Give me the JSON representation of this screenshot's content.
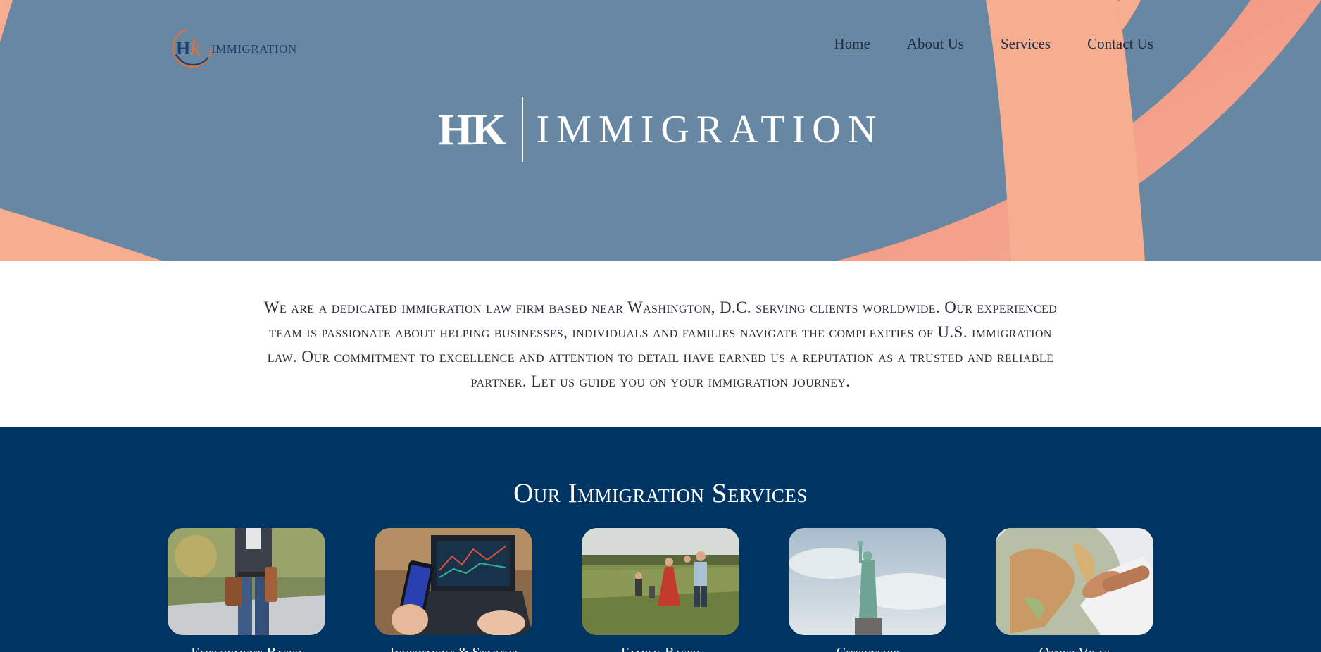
{
  "header": {
    "logo_text": "IMMIGRATION",
    "logo_mark_text": "HK"
  },
  "nav": {
    "items": [
      {
        "label": "Home",
        "active": true
      },
      {
        "label": "About Us",
        "active": false
      },
      {
        "label": "Services",
        "active": false
      },
      {
        "label": "Contact Us",
        "active": false
      }
    ]
  },
  "hero": {
    "brand_hk": "HK",
    "brand_word": "IMMIGRATION"
  },
  "intro": {
    "text": "We are a dedicated immigration law firm based near Washington, D.C. serving clients worldwide. Our experienced team is passionate about helping businesses, individuals and families navigate the complexities of U.S. immigration law. Our commitment to excellence and attention to detail have earned us a reputation as a trusted and reliable partner. Let us guide you on your immigration journey."
  },
  "services": {
    "title": "Our Immigration Services",
    "cards": [
      {
        "label": "Employment-Based",
        "image": "businessman-with-briefcase"
      },
      {
        "label": "Investment & Startup",
        "image": "phone-and-laptop-trading"
      },
      {
        "label": "Family-Based",
        "image": "family-in-field"
      },
      {
        "label": "Citizenship",
        "image": "statue-of-liberty"
      },
      {
        "label": "Other Visas",
        "image": "hand-on-globe"
      }
    ]
  },
  "colors": {
    "hero_bg": "#6787a2",
    "ribbon": "#f6ad90",
    "ribbon_dark": "#e58c7e",
    "navy": "#003462",
    "logo_orange": "#e0703a",
    "logo_navy": "#1c3f6e"
  }
}
